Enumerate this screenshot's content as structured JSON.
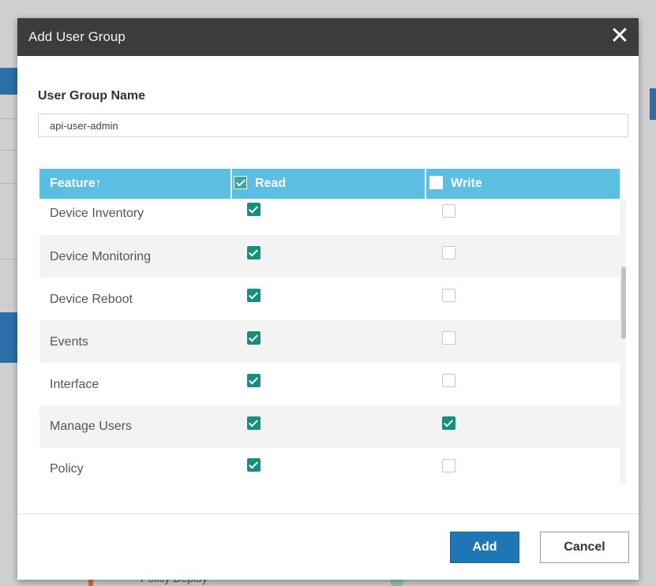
{
  "dialog": {
    "title": "Add User Group",
    "close_label": "✕"
  },
  "form": {
    "name_label": "User Group Name",
    "name_value": "api-user-admin"
  },
  "table": {
    "headers": {
      "feature": "Feature↑",
      "read": "Read",
      "write": "Write"
    },
    "header_read_checked": true,
    "header_write_checked": false,
    "rows": [
      {
        "feature": "Device Inventory",
        "read": true,
        "write": false
      },
      {
        "feature": "Device Monitoring",
        "read": true,
        "write": false
      },
      {
        "feature": "Device Reboot",
        "read": true,
        "write": false
      },
      {
        "feature": "Events",
        "read": true,
        "write": false
      },
      {
        "feature": "Interface",
        "read": true,
        "write": false
      },
      {
        "feature": "Manage Users",
        "read": true,
        "write": true
      },
      {
        "feature": "Policy",
        "read": true,
        "write": false
      }
    ]
  },
  "footer": {
    "add_label": "Add",
    "cancel_label": "Cancel"
  },
  "background": {
    "partial_row_text": "Policy Deploy"
  },
  "colors": {
    "header_bar": "#3c3c3c",
    "table_header": "#5bbfe3",
    "checkbox_checked": "#14907e",
    "primary_button": "#1f76b5"
  },
  "icons": {
    "close": "close-icon",
    "checkbox_checked": "checkmark-icon"
  }
}
